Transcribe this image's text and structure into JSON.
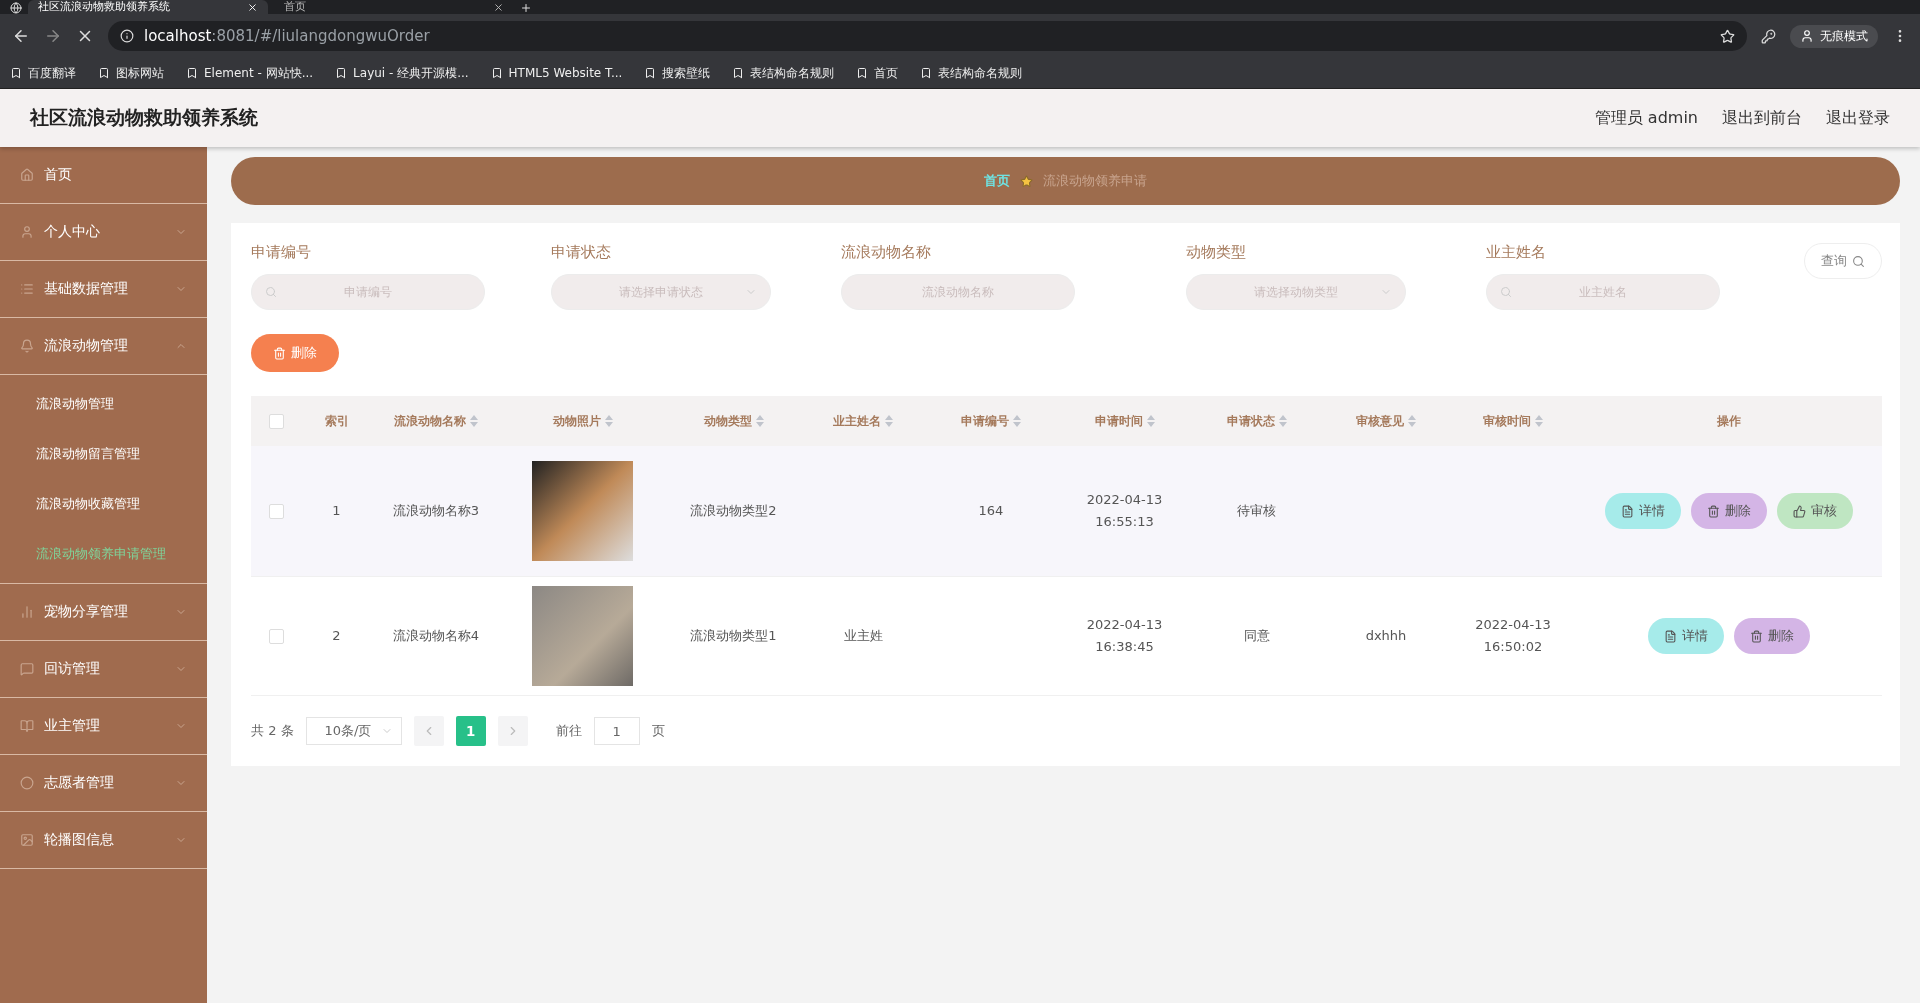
{
  "browser": {
    "tabs": [
      {
        "title": "社区流浪动物救助领养系统",
        "selected": true
      },
      {
        "title": "首页",
        "selected": false
      }
    ],
    "url_host": "localhost",
    "url_rest": ":8081/#/liulangdongwuOrder",
    "incognito_label": "无痕模式",
    "bookmarks": [
      {
        "label": "百度翻译"
      },
      {
        "label": "图标网站"
      },
      {
        "label": "Element - 网站快..."
      },
      {
        "label": "Layui - 经典开源模..."
      },
      {
        "label": "HTML5 Website T..."
      },
      {
        "label": "搜索壁纸"
      },
      {
        "label": "表结构命名规则"
      },
      {
        "label": "首页"
      },
      {
        "label": "表结构命名规则"
      }
    ]
  },
  "header": {
    "title": "社区流浪动物救助领养系统",
    "links": [
      "管理员 admin",
      "退出到前台",
      "退出登录"
    ]
  },
  "sidebar": {
    "items": [
      {
        "label": "首页"
      },
      {
        "label": "个人中心"
      },
      {
        "label": "基础数据管理"
      },
      {
        "label": "流浪动物管理",
        "children": [
          {
            "label": "流浪动物管理",
            "selected": false
          },
          {
            "label": "流浪动物留言管理",
            "selected": false
          },
          {
            "label": "流浪动物收藏管理",
            "selected": false
          },
          {
            "label": "流浪动物领养申请管理",
            "selected": true
          }
        ]
      },
      {
        "label": "宠物分享管理"
      },
      {
        "label": "回访管理"
      },
      {
        "label": "业主管理"
      },
      {
        "label": "志愿者管理"
      },
      {
        "label": "轮播图信息"
      }
    ]
  },
  "breadcrumb": [
    {
      "label": "首页",
      "current": false
    },
    {
      "label": "流浪动物领养申请",
      "current": true
    }
  ],
  "filters": [
    {
      "label": "申请编号",
      "placeholder": "申请编号",
      "kind": "search"
    },
    {
      "label": "申请状态",
      "placeholder": "请选择申请状态",
      "kind": "select"
    },
    {
      "label": "流浪动物名称",
      "placeholder": "流浪动物名称",
      "kind": "text"
    },
    {
      "label": "动物类型",
      "placeholder": "请选择动物类型",
      "kind": "select"
    },
    {
      "label": "业主姓名",
      "placeholder": "业主姓名",
      "kind": "search"
    }
  ],
  "search_button": "查询",
  "delete_button": "删除",
  "table": {
    "header_checked": false,
    "columns": [
      {
        "label": "索引",
        "sortable": false
      },
      {
        "label": "流浪动物名称",
        "sortable": true
      },
      {
        "label": "动物照片",
        "sortable": true
      },
      {
        "label": "动物类型",
        "sortable": true
      },
      {
        "label": "业主姓名",
        "sortable": true
      },
      {
        "label": "申请编号",
        "sortable": true
      },
      {
        "label": "申请时间",
        "sortable": true
      },
      {
        "label": "申请状态",
        "sortable": true
      },
      {
        "label": "审核意见",
        "sortable": true
      },
      {
        "label": "审核时间",
        "sortable": true
      },
      {
        "label": "操作",
        "sortable": false
      }
    ],
    "rows": [
      {
        "checked": false,
        "cells": [
          "1",
          "流浪动物名称3",
          null,
          "流浪动物类型2",
          null,
          "164",
          "2022-04-13 16:55:13",
          "待审核",
          null,
          null
        ],
        "actions": [
          {
            "label": "详情",
            "kind": "detail"
          },
          {
            "label": "删除",
            "kind": "delete"
          },
          {
            "label": "审核",
            "kind": "review"
          }
        ]
      },
      {
        "checked": false,
        "cells": [
          "2",
          "流浪动物名称4",
          null,
          "流浪动物类型1",
          "业主姓",
          null,
          "2022-04-13 16:38:45",
          "同意",
          "dxhhh",
          "2022-04-13 16:50:02"
        ],
        "actions": [
          {
            "label": "详情",
            "kind": "detail"
          },
          {
            "label": "删除",
            "kind": "delete"
          }
        ]
      }
    ]
  },
  "pagination": {
    "total": "共 2 条",
    "page_size": "10条/页",
    "pages": [
      {
        "label": "1",
        "selected": true
      }
    ],
    "goto_label": "前往",
    "goto_value": "1",
    "goto_suffix": "页"
  }
}
